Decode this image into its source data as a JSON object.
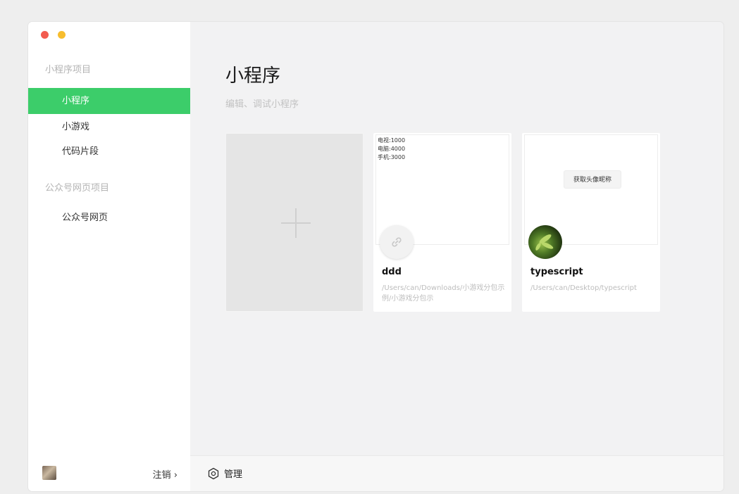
{
  "sidebar": {
    "section1_title": "小程序项目",
    "items1": [
      {
        "label": "小程序"
      },
      {
        "label": "小游戏"
      },
      {
        "label": "代码片段"
      }
    ],
    "section2_title": "公众号网页项目",
    "items2": [
      {
        "label": "公众号网页"
      }
    ],
    "logout_label": "注销 ›",
    "active_color": "#3ccd6a"
  },
  "main": {
    "title": "小程序",
    "subtitle": "编辑、调试小程序",
    "add_icon": "plus-icon",
    "projects": [
      {
        "name": "ddd",
        "path": "/Users/can/Downloads/小游戏分包示例/小游戏分包示",
        "preview_lines": [
          "电视:1000",
          "电脑:4000",
          "手机:3000"
        ],
        "icon": "link-icon"
      },
      {
        "name": "typescript",
        "path": "/Users/can/Desktop/typescript",
        "preview_button": "获取头像昵称",
        "icon": "avatar-plant"
      }
    ]
  },
  "footer": {
    "manage_label": "管理",
    "manage_icon": "gear-icon"
  }
}
